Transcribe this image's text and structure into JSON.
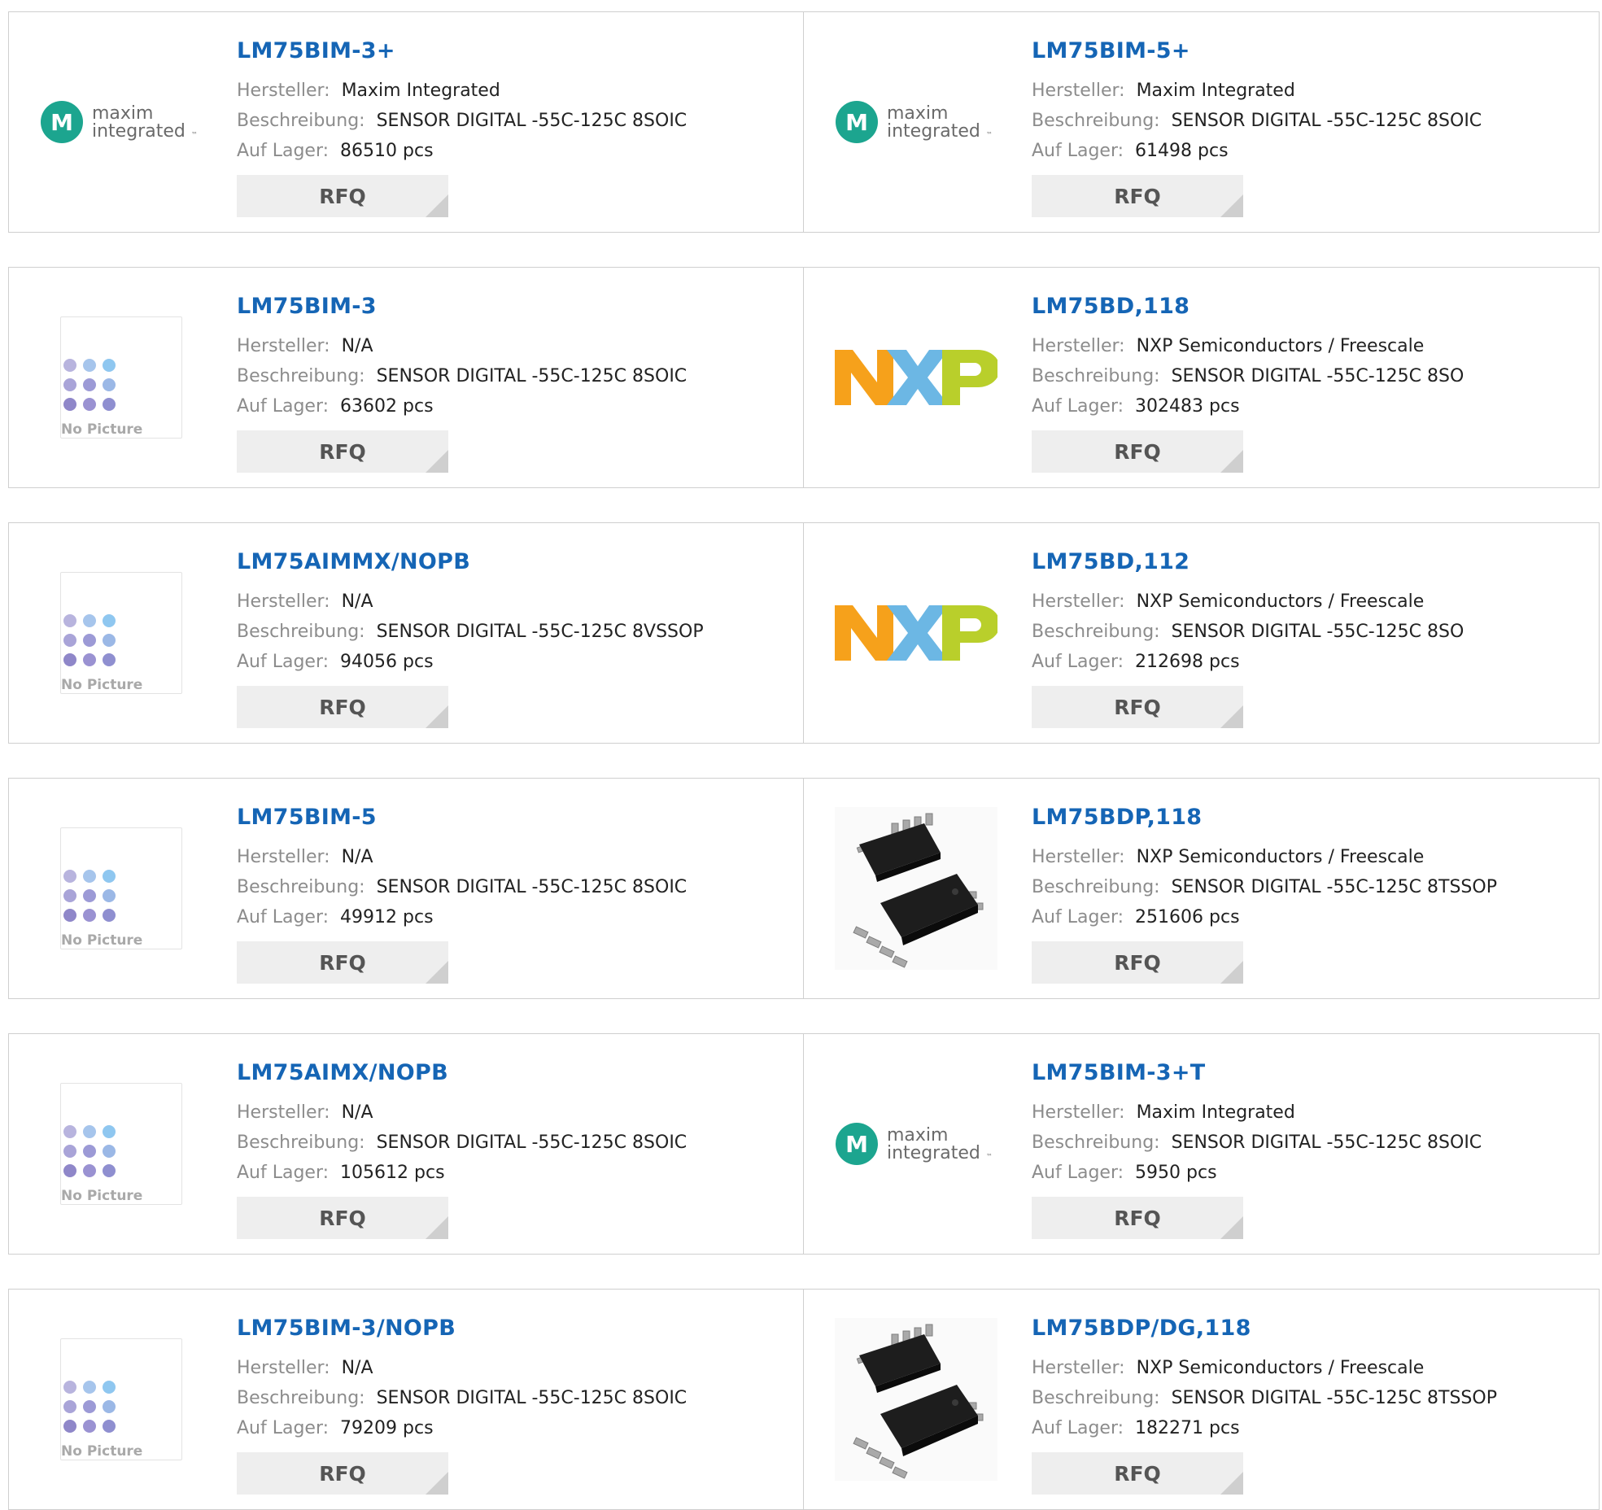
{
  "labels": {
    "manufacturer": "Hersteller:",
    "description": "Beschreibung:",
    "stock": "Auf Lager:",
    "rfq": "RFQ",
    "no_picture": "No Picture"
  },
  "brands": {
    "maxim_line1": "maxim",
    "maxim_line2": "integrated",
    "maxim_tm": "™",
    "nxp_text": "NXP"
  },
  "colors": {
    "link": "#1565b5",
    "maxim_teal": "#1ca58f",
    "nxp_orange": "#f6a11b",
    "nxp_blue": "#6cb7e4",
    "nxp_green": "#b9cf2b",
    "rfq_bg": "#eeeeee"
  },
  "products": [
    {
      "part": "LM75BIM-3+",
      "manufacturer": "Maxim Integrated",
      "description": "SENSOR DIGITAL -55C-125C 8SOIC",
      "stock": "86510 pcs",
      "image": "maxim-logo"
    },
    {
      "part": "LM75BIM-5+",
      "manufacturer": "Maxim Integrated",
      "description": "SENSOR DIGITAL -55C-125C 8SOIC",
      "stock": "61498 pcs",
      "image": "maxim-logo"
    },
    {
      "part": "LM75BIM-3",
      "manufacturer": "N/A",
      "description": "SENSOR DIGITAL -55C-125C 8SOIC",
      "stock": "63602 pcs",
      "image": "no-picture"
    },
    {
      "part": "LM75BD,118",
      "manufacturer": "NXP Semiconductors / Freescale",
      "description": "SENSOR DIGITAL -55C-125C 8SO",
      "stock": "302483 pcs",
      "image": "nxp-logo"
    },
    {
      "part": "LM75AIMMX/NOPB",
      "manufacturer": "N/A",
      "description": "SENSOR DIGITAL -55C-125C 8VSSOP",
      "stock": "94056 pcs",
      "image": "no-picture"
    },
    {
      "part": "LM75BD,112",
      "manufacturer": "NXP Semiconductors / Freescale",
      "description": "SENSOR DIGITAL -55C-125C 8SO",
      "stock": "212698 pcs",
      "image": "nxp-logo"
    },
    {
      "part": "LM75BIM-5",
      "manufacturer": "N/A",
      "description": "SENSOR DIGITAL -55C-125C 8SOIC",
      "stock": "49912 pcs",
      "image": "no-picture"
    },
    {
      "part": "LM75BDP,118",
      "manufacturer": "NXP Semiconductors / Freescale",
      "description": "SENSOR DIGITAL -55C-125C 8TSSOP",
      "stock": "251606 pcs",
      "image": "chip-photo"
    },
    {
      "part": "LM75AIMX/NOPB",
      "manufacturer": "N/A",
      "description": "SENSOR DIGITAL -55C-125C 8SOIC",
      "stock": "105612 pcs",
      "image": "no-picture"
    },
    {
      "part": "LM75BIM-3+T",
      "manufacturer": "Maxim Integrated",
      "description": "SENSOR DIGITAL -55C-125C 8SOIC",
      "stock": "5950 pcs",
      "image": "maxim-logo"
    },
    {
      "part": "LM75BIM-3/NOPB",
      "manufacturer": "N/A",
      "description": "SENSOR DIGITAL -55C-125C 8SOIC",
      "stock": "79209 pcs",
      "image": "no-picture"
    },
    {
      "part": "LM75BDP/DG,118",
      "manufacturer": "NXP Semiconductors / Freescale",
      "description": "SENSOR DIGITAL -55C-125C 8TSSOP",
      "stock": "182271 pcs",
      "image": "chip-photo"
    }
  ]
}
